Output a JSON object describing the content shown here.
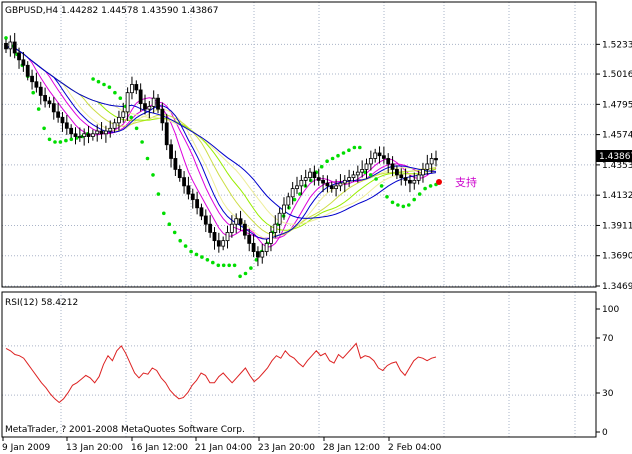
{
  "chart_data": [
    {
      "type": "candlestick",
      "symbol_header": "GBPUSD,H4  1.44282 1.44578 1.43590 1.43867",
      "current_price_label": "1.43867",
      "annotation_text": "支持",
      "ylim": [
        1.3469,
        1.5323
      ],
      "y_ticks": [
        "1.52330",
        "1.50160",
        "1.47950",
        "1.45740",
        "1.43530",
        "1.41320",
        "1.39110",
        "1.36900",
        "1.34690"
      ],
      "x_ticks": [
        "9 Jan 2009",
        "13 Jan 20:00",
        "16 Jan 12:00",
        "21 Jan 04:00",
        "23 Jan 20:00",
        "28 Jan 12:00",
        "2 Feb 04:00"
      ],
      "close": [
        1.52,
        1.525,
        1.517,
        1.512,
        1.508,
        1.5,
        1.496,
        1.492,
        1.486,
        1.482,
        1.48,
        1.474,
        1.47,
        1.466,
        1.462,
        1.458,
        1.456,
        1.456,
        1.458,
        1.456,
        1.458,
        1.46,
        1.458,
        1.46,
        1.462,
        1.466,
        1.47,
        1.474,
        1.488,
        1.494,
        1.49,
        1.48,
        1.476,
        1.478,
        1.484,
        1.476,
        1.466,
        1.45,
        1.44,
        1.432,
        1.426,
        1.42,
        1.414,
        1.41,
        1.404,
        1.398,
        1.392,
        1.386,
        1.38,
        1.376,
        1.38,
        1.386,
        1.392,
        1.396,
        1.392,
        1.384,
        1.378,
        1.372,
        1.368,
        1.372,
        1.378,
        1.386,
        1.392,
        1.4,
        1.406,
        1.412,
        1.418,
        1.42,
        1.424,
        1.426,
        1.43,
        1.426,
        1.424,
        1.422,
        1.42,
        1.418,
        1.42,
        1.422,
        1.424,
        1.426,
        1.428,
        1.43,
        1.432,
        1.436,
        1.44,
        1.444,
        1.442,
        1.44,
        1.436,
        1.432,
        1.428,
        1.426,
        1.424,
        1.422,
        1.424,
        1.428,
        1.432,
        1.436,
        1.44,
        1.439
      ],
      "sar": [
        1.528,
        1.522,
        1.516,
        1.508,
        1.5,
        1.488,
        1.476,
        1.462,
        1.454,
        1.452,
        1.452,
        1.453,
        1.454,
        1.455,
        1.456,
        1.458,
        1.498,
        1.496,
        1.494,
        1.492,
        1.488,
        1.484,
        1.478,
        1.47,
        1.462,
        1.452,
        1.44,
        1.428,
        1.414,
        1.4,
        1.392,
        1.386,
        1.38,
        1.376,
        1.372,
        1.37,
        1.368,
        1.366,
        1.364,
        1.362,
        1.362,
        1.362,
        1.362,
        1.354,
        1.356,
        1.36,
        1.366,
        1.372,
        1.378,
        1.386,
        1.392,
        1.398,
        1.404,
        1.41,
        1.414,
        1.42,
        1.424,
        1.43,
        1.434,
        1.438,
        1.44,
        1.442,
        1.444,
        1.446,
        1.448,
        1.448,
        1.43,
        1.428,
        1.425,
        1.42,
        1.412,
        1.408,
        1.406,
        1.405,
        1.406,
        1.41,
        1.414,
        1.418,
        1.42,
        1.421
      ],
      "rsi_label": "RSI(12) 58.4212",
      "rsi_ylim": [
        0,
        100
      ],
      "rsi_ticks": [
        "100",
        "70",
        "30",
        "0"
      ],
      "rsi": [
        68,
        66,
        63,
        62,
        60,
        55,
        50,
        45,
        40,
        36,
        31,
        27,
        24,
        27,
        32,
        38,
        40,
        43,
        46,
        44,
        40,
        45,
        55,
        62,
        58,
        66,
        70,
        64,
        56,
        48,
        44,
        48,
        47,
        52,
        50,
        44,
        40,
        34,
        30,
        27,
        28,
        32,
        38,
        42,
        48,
        46,
        40,
        40,
        45,
        48,
        44,
        40,
        44,
        48,
        52,
        46,
        41,
        44,
        48,
        52,
        58,
        62,
        60,
        66,
        62,
        60,
        56,
        53,
        58,
        62,
        66,
        62,
        64,
        58,
        56,
        63,
        60,
        64,
        68,
        72,
        60,
        62,
        61,
        58,
        52,
        50,
        54,
        56,
        57,
        50,
        46,
        52,
        58,
        61,
        60,
        58,
        60,
        61
      ],
      "footer_text": "MetaTrader, ? 2001-2008 MetaQuotes Software Corp.",
      "colors": {
        "bull_body": "#ffffff",
        "bear_body": "#000000",
        "candle_wick": "#000000",
        "sar": "#00dd00",
        "rsi": "#dd2222",
        "grid": "#aab4c8",
        "annotation_dot": "#ee0000",
        "ma_blue": "#0000cc",
        "ma_magenta": "#dd00dd",
        "ma_yellow": "#ccdd44",
        "ma_lime": "#99ee00",
        "ma_pale": "#eeee99"
      }
    }
  ]
}
